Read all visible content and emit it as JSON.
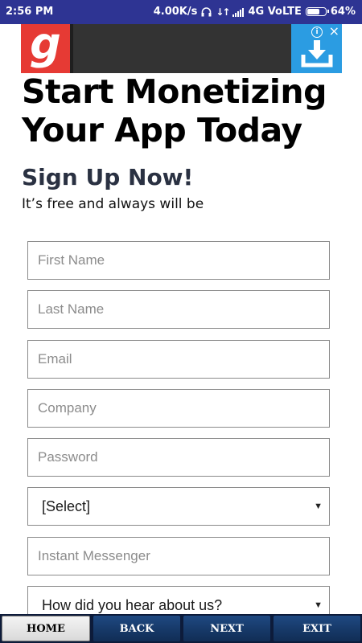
{
  "status_bar": {
    "time": "2:56 PM",
    "network_speed": "4.00K/s",
    "network_type": "4G VoLTE",
    "battery_percent": "64%",
    "icons": [
      "headphones-icon",
      "data-arrows-icon",
      "signal-icon",
      "battery-icon"
    ]
  },
  "ad_banner": {
    "logo_letter": "g",
    "info_symbol": "i",
    "close_symbol": "×",
    "colors": {
      "logo": "#e63a34",
      "download": "#2b9ce2",
      "background": "#333333"
    }
  },
  "page": {
    "headline": "Start Monetizing Your App Today",
    "signup_title": "Sign Up Now!",
    "signup_subtitle": "It’s free and always will be"
  },
  "form": {
    "first_name": {
      "placeholder": "First Name",
      "value": ""
    },
    "last_name": {
      "placeholder": "Last Name",
      "value": ""
    },
    "email": {
      "placeholder": "Email",
      "value": ""
    },
    "company": {
      "placeholder": "Company",
      "value": ""
    },
    "password": {
      "placeholder": "Password",
      "value": ""
    },
    "select": {
      "selected": "[Select]"
    },
    "instant_messenger": {
      "placeholder": "Instant Messenger",
      "value": ""
    },
    "hear_about": {
      "selected": "How did you hear about us?"
    }
  },
  "bottom_nav": {
    "home": "HOME",
    "back": "BACK",
    "next": "NEXT",
    "exit": "EXIT",
    "active": "home"
  }
}
